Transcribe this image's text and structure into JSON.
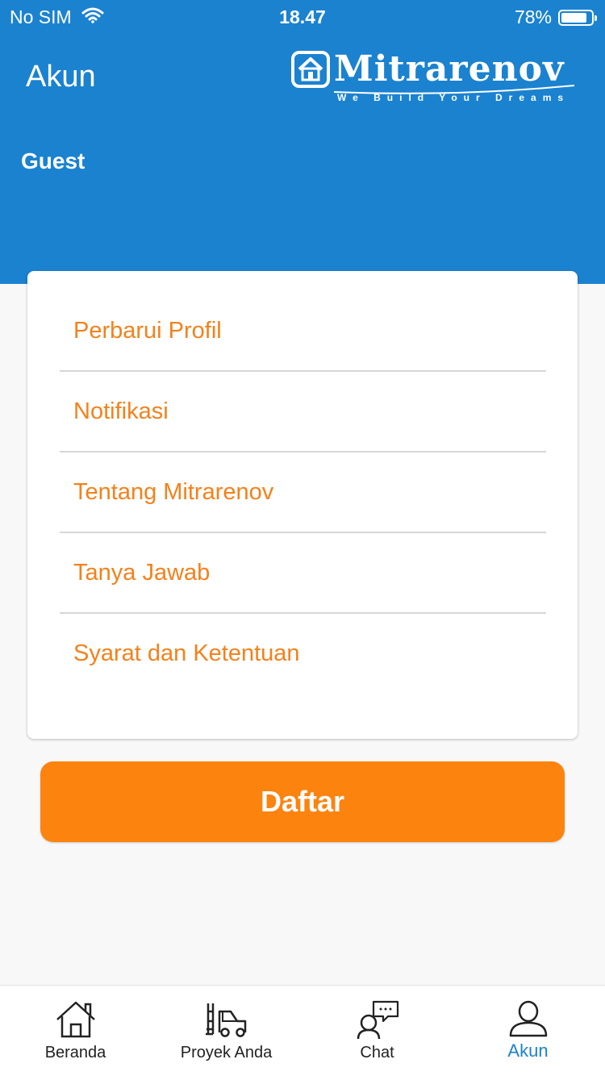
{
  "status_bar": {
    "carrier": "No SIM",
    "time": "18.47",
    "battery": "78%",
    "battery_level": 0.78
  },
  "header": {
    "title": "Akun",
    "brand_name": "Mitrarenov",
    "brand_tagline": "We Build Your Dreams"
  },
  "profile": {
    "name": "Guest"
  },
  "menu": {
    "items": [
      {
        "label": "Perbarui Profil"
      },
      {
        "label": "Notifikasi"
      },
      {
        "label": "Tentang Mitrarenov"
      },
      {
        "label": "Tanya Jawab"
      },
      {
        "label": "Syarat dan Ketentuan"
      }
    ]
  },
  "register_button": {
    "label": "Daftar"
  },
  "tabs": [
    {
      "label": "Beranda",
      "icon": "home-icon"
    },
    {
      "label": "Proyek Anda",
      "icon": "forklift-icon"
    },
    {
      "label": "Chat",
      "icon": "chat-icon"
    },
    {
      "label": "Akun",
      "icon": "user-icon",
      "active": true
    }
  ],
  "colors": {
    "primary": "#1b82d0",
    "accent": "#fd830f",
    "menu_text": "#f4811b",
    "background": "#f8f8f8"
  }
}
